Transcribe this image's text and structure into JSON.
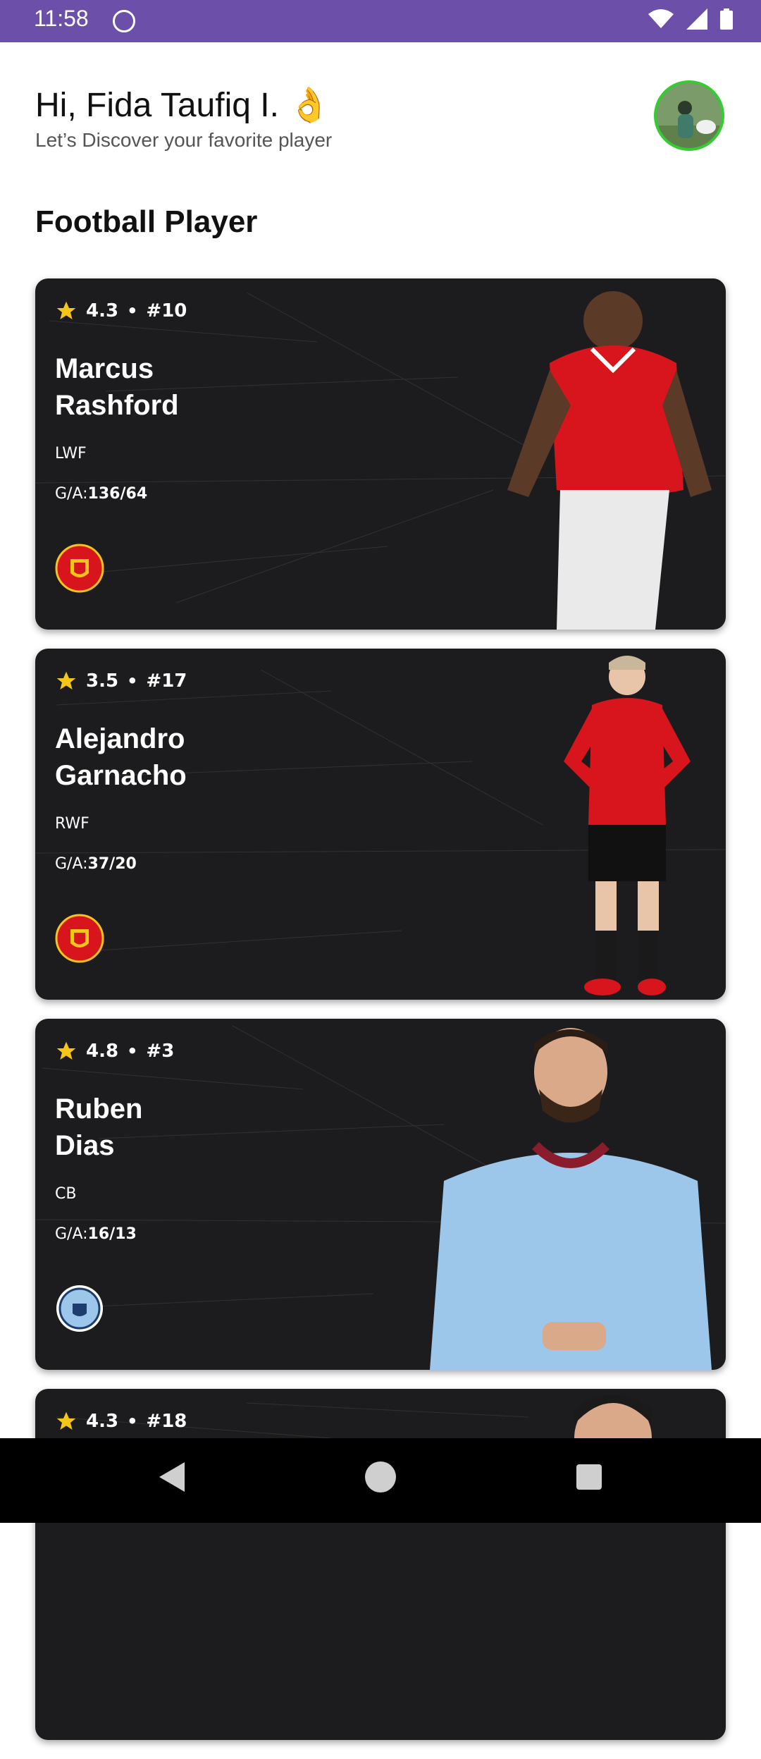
{
  "status_bar": {
    "time": "11:58",
    "background": "#6b4fa8"
  },
  "header": {
    "greeting": "Hi, Fida Taufiq I. 👌",
    "subtitle": "Let’s Discover your favorite player"
  },
  "section_title": "Football Player",
  "players": [
    {
      "rating": "4.3",
      "number": "#10",
      "name_line1": "Marcus",
      "name_line2": "Rashford",
      "position": "LWF",
      "ga_label": "G/A:",
      "ga_value": "136/64",
      "club": "Manchester United",
      "club_icon": "man-united-crest-icon"
    },
    {
      "rating": "3.5",
      "number": "#17",
      "name_line1": "Alejandro",
      "name_line2": "Garnacho",
      "position": "RWF",
      "ga_label": "G/A:",
      "ga_value": "37/20",
      "club": "Manchester United",
      "club_icon": "man-united-crest-icon"
    },
    {
      "rating": "4.8",
      "number": "#3",
      "name_line1": "Ruben",
      "name_line2": "Dias",
      "position": "CB",
      "ga_label": "G/A:",
      "ga_value": "16/13",
      "club": "Manchester City",
      "club_icon": "man-city-crest-icon"
    },
    {
      "rating": "4.3",
      "number": "#18"
    }
  ],
  "colors": {
    "card_bg": "#1c1c1e",
    "star": "#f5c518",
    "united_red": "#d8151c",
    "city_blue": "#9cc6ea",
    "avatar_border": "#33cc33"
  }
}
